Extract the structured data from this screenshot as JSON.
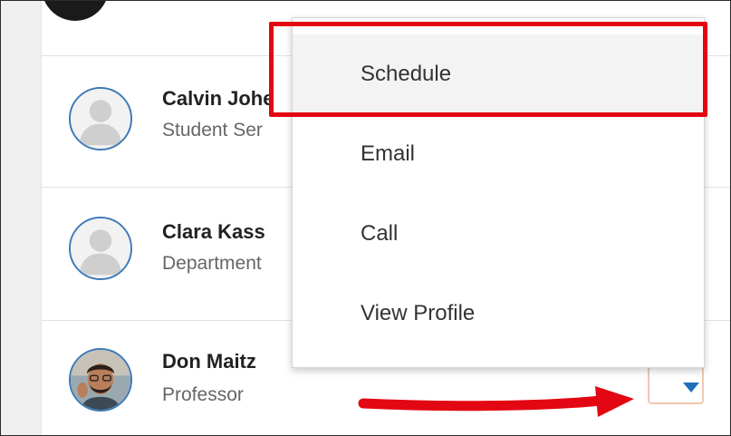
{
  "contacts": [
    {
      "name": "Calvin Johe",
      "title": "Student Ser"
    },
    {
      "name": "Clara Kass",
      "title": "Department"
    },
    {
      "name": "Don Maitz",
      "title": "Professor"
    }
  ],
  "menu": {
    "items": [
      {
        "label": "Schedule"
      },
      {
        "label": "Email"
      },
      {
        "label": "Call"
      },
      {
        "label": "View Profile"
      }
    ]
  },
  "colors": {
    "highlight": "#e30613",
    "arrow": "#e30613",
    "avatar_border": "#3d7ab8",
    "caret": "#1f6fb8"
  },
  "icons": {
    "placeholder_avatar": "user-silhouette-icon",
    "dropdown_caret": "caret-down-icon",
    "annotation_arrow": "arrow-right-annotation"
  }
}
